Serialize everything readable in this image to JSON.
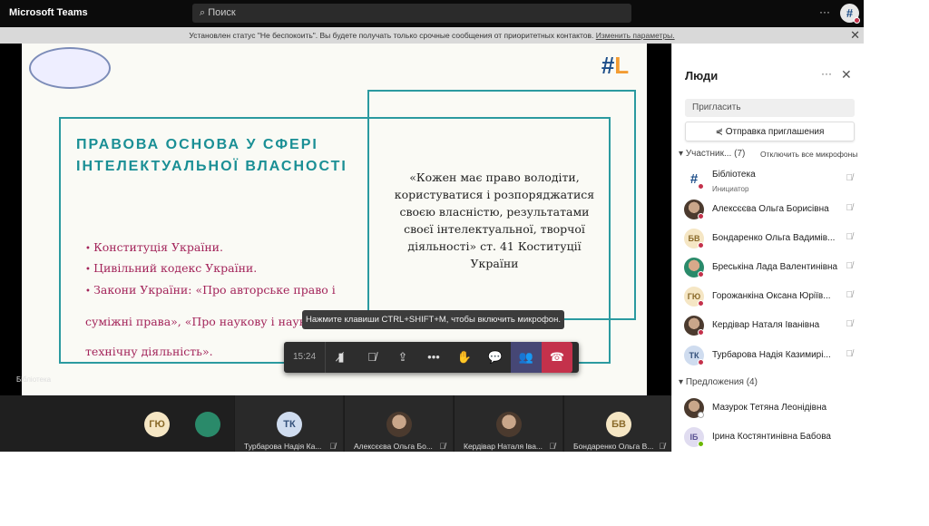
{
  "topbar": {
    "app_name": "Microsoft Teams",
    "search_placeholder": "Поиск",
    "more": "···",
    "avatar": "#"
  },
  "notification": {
    "text": "Установлен статус \"Не беспокоить\". Вы будете получать только срочные сообщения от приоритетных контактов.",
    "link": "Изменить параметры.",
    "close": "✕"
  },
  "slide": {
    "title": "ПРАВОВА ОСНОВА У СФЕРІ ІНТЕЛЕКТУАЛЬНОЇ ВЛАСНОСТІ",
    "bullets": [
      "Конституція України.",
      "Цивільний кодекс України.",
      "Закони України: «Про авторське право і суміжні права», «Про наукову і науково-технічну діяльність»."
    ],
    "quote": "«Кожен має право володіти, користуватися і розпоряджатися своєю власністю, результатами своєї інтелектуальної, творчої діяльності» ст. 41 Коституції України"
  },
  "stage": {
    "presenter_name": "Бібліотека",
    "tooltip": "Нажмите клавиши CTRL+SHIFT+M, чтобы включить микрофон."
  },
  "callbar": {
    "timer": "15:24"
  },
  "strip": {
    "tiles": [
      {
        "initials": "ГЮ"
      },
      {
        "initials": ""
      },
      {
        "initials": "ТК",
        "name": "Турбарова Надія Ка..."
      },
      {
        "initials": "",
        "name": "Алексєєва Ольга Бо..."
      },
      {
        "initials": "",
        "name": "Кердівар Наталя Іва..."
      },
      {
        "initials": "БВ",
        "name": "Бондаренко Ольга В..."
      }
    ]
  },
  "panel": {
    "title": "Люди",
    "more": "···",
    "close": "✕",
    "invite_placeholder": "Пригласить",
    "send_invite": "Отправка приглашения",
    "participants_label": "Участник...",
    "participants_count": "(7)",
    "mute_all": "Отключить все микрофоны",
    "participants": [
      {
        "initials": "#",
        "name": "Бібліотека",
        "role": "Инициатор"
      },
      {
        "initials": "",
        "name": "Алексєєва Ольга Борисівна"
      },
      {
        "initials": "БВ",
        "name": "Бондаренко Ольга Вадимів..."
      },
      {
        "initials": "",
        "name": "Бреськіна Лада Валентинівна"
      },
      {
        "initials": "ГЮ",
        "name": "Горожанкіна Оксана Юріїв..."
      },
      {
        "initials": "",
        "name": "Кердівар Наталя Іванівна"
      },
      {
        "initials": "ТК",
        "name": "Турбарова Надія Казимирі..."
      }
    ],
    "suggestions_label": "Предложения (4)",
    "suggestions": [
      {
        "initials": "",
        "name": "Мазурок Тетяна Леонідівна"
      },
      {
        "initials": "ІБ",
        "name": "Ірина Костянтинівна Бабова"
      }
    ]
  },
  "colors": {
    "accent": "#464775",
    "hangup": "#c4314b",
    "slide_teal": "#1a8f95",
    "slide_magenta": "#a3245a"
  }
}
